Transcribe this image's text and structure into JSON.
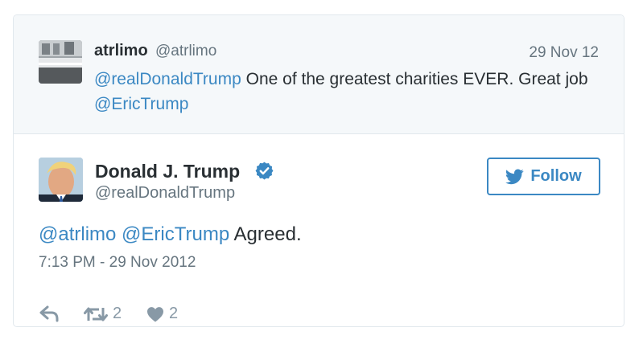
{
  "parent_tweet": {
    "display_name": "atrlimo",
    "handle": "@atrlimo",
    "date": "29 Nov 12",
    "mention_1": "@realDonaldTrump",
    "text_1": " One of the greatest charities EVER. Great job ",
    "mention_2": "@EricTrump"
  },
  "tweet": {
    "display_name": "Donald J. Trump",
    "handle": "@realDonaldTrump",
    "follow_label": "Follow",
    "mention_1": "@atrlimo",
    "mention_2": "@EricTrump",
    "text": " Agreed.",
    "timestamp": "7:13 PM - 29 Nov 2012",
    "retweet_count": "2",
    "like_count": "2"
  },
  "colors": {
    "accent": "#3b88c3",
    "text": "#292f33",
    "muted": "#66757f",
    "action_gray": "#8899a6",
    "parent_background": "#f5f8fa"
  },
  "icons": {
    "verified": "verified-badge-icon",
    "follow": "bird-icon",
    "reply": "reply-icon",
    "retweet": "retweet-icon",
    "like": "heart-icon"
  }
}
